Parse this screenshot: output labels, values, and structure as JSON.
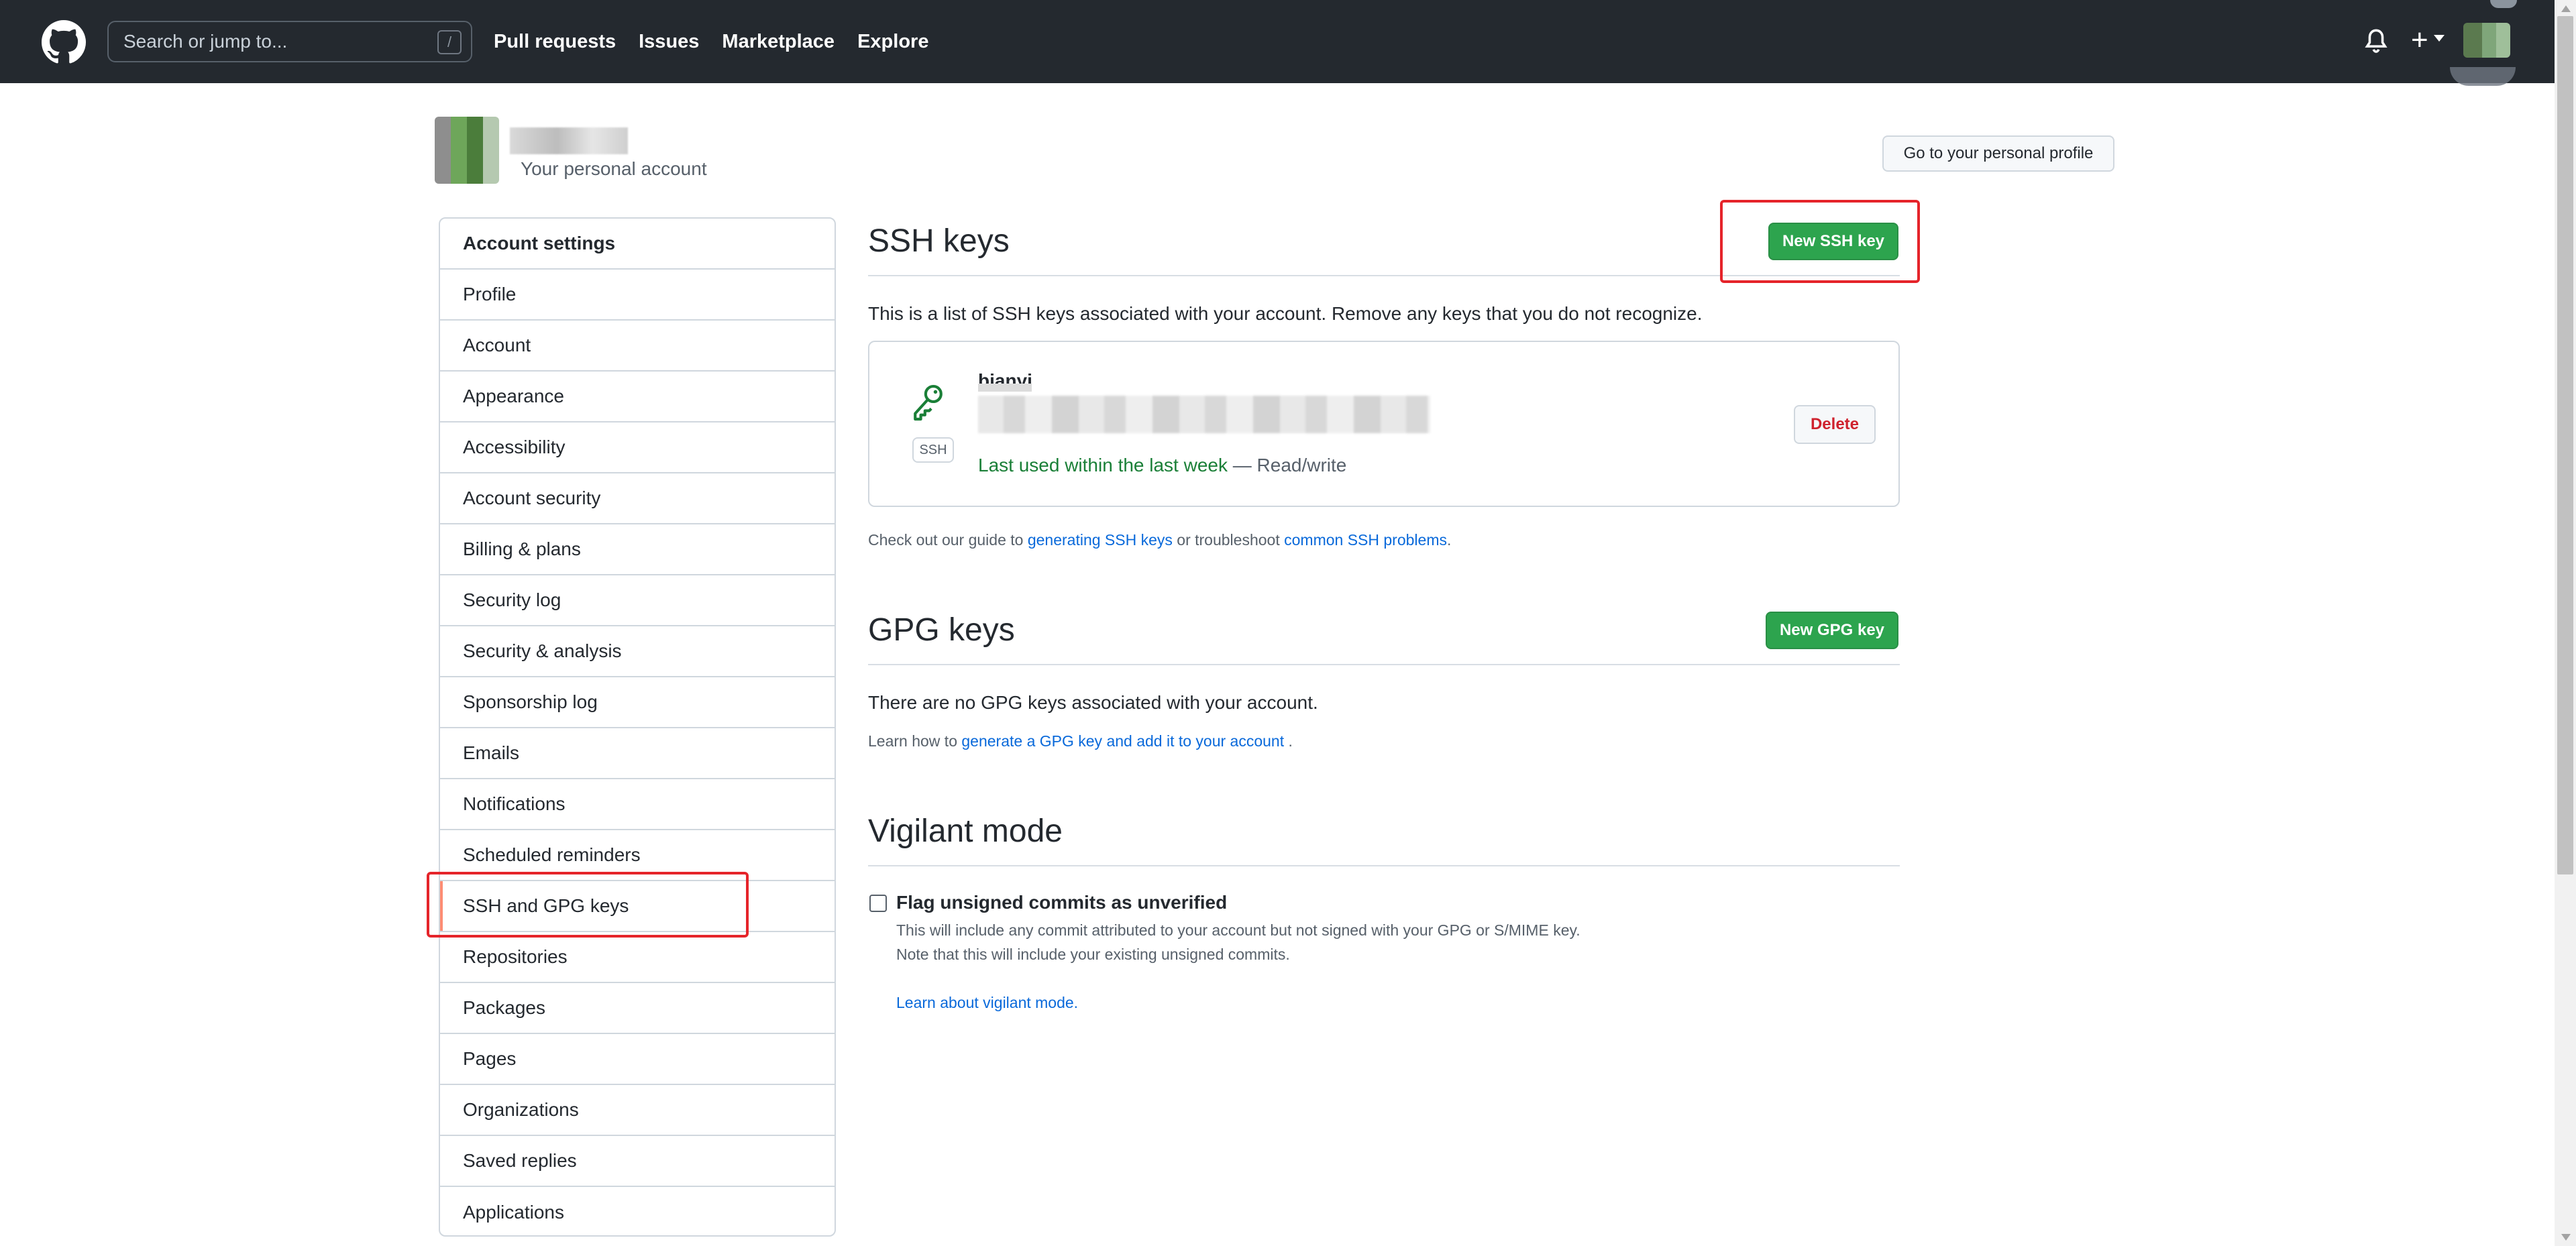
{
  "header": {
    "search_placeholder": "Search or jump to...",
    "search_shortcut": "/",
    "nav": [
      "Pull requests",
      "Issues",
      "Marketplace",
      "Explore"
    ],
    "plus": "+"
  },
  "account": {
    "subtitle": "Your personal account",
    "profile_button": "Go to your personal profile"
  },
  "sidebar": {
    "heading": "Account settings",
    "items": [
      "Profile",
      "Account",
      "Appearance",
      "Accessibility",
      "Account security",
      "Billing & plans",
      "Security log",
      "Security & analysis",
      "Sponsorship log",
      "Emails",
      "Notifications",
      "Scheduled reminders",
      "SSH and GPG keys",
      "Repositories",
      "Packages",
      "Pages",
      "Organizations",
      "Saved replies",
      "Applications"
    ],
    "active_index": 12
  },
  "ssh": {
    "title": "SSH keys",
    "new_button": "New SSH key",
    "description": "This is a list of SSH keys associated with your account. Remove any keys that you do not recognize.",
    "key": {
      "title": "bianyi",
      "badge": "SSH",
      "last_used": "Last used within the last week",
      "access": " — Read/write",
      "delete_button": "Delete"
    },
    "guide_prefix": "Check out our guide to ",
    "guide_link1": "generating SSH keys",
    "guide_mid": " or troubleshoot ",
    "guide_link2": "common SSH problems",
    "guide_suffix": "."
  },
  "gpg": {
    "title": "GPG keys",
    "new_button": "New GPG key",
    "empty_text": "There are no GPG keys associated with your account.",
    "learn_prefix": "Learn how to ",
    "learn_link": "generate a GPG key and add it to your account",
    "learn_suffix": " ."
  },
  "vigilant": {
    "title": "Vigilant mode",
    "checkbox_label": "Flag unsigned commits as unverified",
    "checked": false,
    "note1": "This will include any commit attributed to your account but not signed with your GPG or S/MIME key.",
    "note2": "Note that this will include your existing unsigned commits.",
    "learn_link": "Learn about vigilant mode."
  },
  "colors": {
    "header_bg": "#24292f",
    "primary_green": "#2da44e",
    "link_blue": "#0969da",
    "danger_red": "#cf222e",
    "highlight_red": "#e5242a",
    "active_accent": "#fd8c73"
  }
}
